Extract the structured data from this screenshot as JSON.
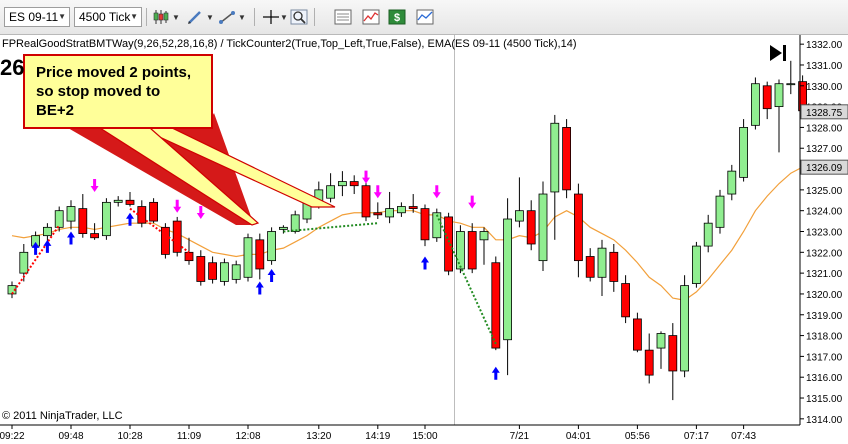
{
  "toolbar": {
    "instrument": "ES 09-11",
    "period": "4500 Tick",
    "icons": [
      "candlestick-icon",
      "chevron-down-icon",
      "pencil-icon",
      "chevron-down-icon",
      "crosshair-icon",
      "chevron-down-icon",
      "zoom-icon",
      "data-box-icon",
      "chart-properties-icon",
      "strategy-icon",
      "indicator-icon"
    ]
  },
  "chart_data": {
    "type": "candlestick",
    "indicator_label": "FPRealGoodStratBMTWay(9,26,52,28,16,8) / TickCounter2(True,Top_Left,True,False), EMA(ES 09-11 (4500 Tick),14)",
    "tick_counter_text": "26",
    "copyright": "© 2011 NinjaTrader, LLC",
    "annotation": "Price moved 2 points,\nso stop moved to\nBE+2",
    "price_ticks": [
      1314.0,
      1315.0,
      1316.0,
      1317.0,
      1318.0,
      1319.0,
      1320.0,
      1321.0,
      1322.0,
      1323.0,
      1324.0,
      1325.0,
      1326.0,
      1327.0,
      1328.0,
      1329.0,
      1330.0,
      1331.0,
      1332.0
    ],
    "price_labels": [
      "1314.00",
      "1315.00",
      "1316.00",
      "1317.00",
      "1318.00",
      "1319.00",
      "1320.00",
      "1321.00",
      "1322.00",
      "1323.00",
      "1324.00",
      "1325.00",
      "1326.00",
      "1327.00",
      "1328.00",
      "1329.00",
      "1330.00",
      "1331.00",
      "1332.00"
    ],
    "ylim": [
      1313.8,
      1332.2
    ],
    "last_price_label": "1328.75",
    "ema_price_label": "1326.09",
    "last_price": 1328.75,
    "ema_price": 1326.09,
    "time_labels": [
      "09:22",
      "09:48",
      "10:28",
      "11:09",
      "12:08",
      "13:20",
      "14:19",
      "15:00",
      "7/21",
      "04:01",
      "05:56",
      "07:17",
      "07:43"
    ],
    "time_label_bars": [
      0,
      5,
      10,
      15,
      20,
      26,
      31,
      35,
      43,
      48,
      53,
      58,
      62
    ],
    "session_break_bar": 37.5,
    "candles": [
      {
        "o": 1320.0,
        "h": 1320.6,
        "l": 1319.8,
        "c": 1320.4
      },
      {
        "o": 1321.0,
        "h": 1322.4,
        "l": 1320.6,
        "c": 1322.0
      },
      {
        "o": 1322.3,
        "h": 1323.0,
        "l": 1322.0,
        "c": 1322.8
      },
      {
        "o": 1322.8,
        "h": 1323.4,
        "l": 1322.4,
        "c": 1323.2
      },
      {
        "o": 1323.2,
        "h": 1324.2,
        "l": 1323.0,
        "c": 1324.0
      },
      {
        "o": 1323.5,
        "h": 1324.5,
        "l": 1323.1,
        "c": 1324.2
      },
      {
        "o": 1324.1,
        "h": 1324.8,
        "l": 1322.7,
        "c": 1322.9
      },
      {
        "o": 1322.9,
        "h": 1323.4,
        "l": 1322.6,
        "c": 1322.7
      },
      {
        "o": 1322.8,
        "h": 1324.6,
        "l": 1322.6,
        "c": 1324.4
      },
      {
        "o": 1324.4,
        "h": 1324.7,
        "l": 1324.2,
        "c": 1324.5
      },
      {
        "o": 1324.5,
        "h": 1324.9,
        "l": 1324.2,
        "c": 1324.3
      },
      {
        "o": 1324.2,
        "h": 1324.5,
        "l": 1323.2,
        "c": 1323.4
      },
      {
        "o": 1324.4,
        "h": 1324.6,
        "l": 1323.4,
        "c": 1323.5
      },
      {
        "o": 1323.2,
        "h": 1323.4,
        "l": 1321.7,
        "c": 1321.9
      },
      {
        "o": 1323.5,
        "h": 1323.7,
        "l": 1321.8,
        "c": 1322.0
      },
      {
        "o": 1322.0,
        "h": 1322.7,
        "l": 1321.4,
        "c": 1321.6
      },
      {
        "o": 1321.8,
        "h": 1322.1,
        "l": 1320.4,
        "c": 1320.6
      },
      {
        "o": 1321.5,
        "h": 1321.8,
        "l": 1320.5,
        "c": 1320.7
      },
      {
        "o": 1320.6,
        "h": 1321.7,
        "l": 1320.4,
        "c": 1321.5
      },
      {
        "o": 1320.7,
        "h": 1321.6,
        "l": 1320.5,
        "c": 1321.4
      },
      {
        "o": 1320.8,
        "h": 1322.9,
        "l": 1320.6,
        "c": 1322.7
      },
      {
        "o": 1322.6,
        "h": 1322.9,
        "l": 1320.7,
        "c": 1321.2
      },
      {
        "o": 1321.6,
        "h": 1323.2,
        "l": 1321.4,
        "c": 1323.0
      },
      {
        "o": 1323.1,
        "h": 1323.3,
        "l": 1322.9,
        "c": 1323.2
      },
      {
        "o": 1323.0,
        "h": 1324.0,
        "l": 1322.9,
        "c": 1323.8
      },
      {
        "o": 1323.6,
        "h": 1324.6,
        "l": 1323.4,
        "c": 1324.4
      },
      {
        "o": 1324.3,
        "h": 1325.4,
        "l": 1324.1,
        "c": 1325.0
      },
      {
        "o": 1324.6,
        "h": 1325.8,
        "l": 1324.4,
        "c": 1325.2
      },
      {
        "o": 1325.2,
        "h": 1325.9,
        "l": 1324.7,
        "c": 1325.4
      },
      {
        "o": 1325.4,
        "h": 1325.7,
        "l": 1324.8,
        "c": 1325.2
      },
      {
        "o": 1325.2,
        "h": 1325.4,
        "l": 1323.5,
        "c": 1323.7
      },
      {
        "o": 1323.9,
        "h": 1324.4,
        "l": 1323.6,
        "c": 1323.8
      },
      {
        "o": 1323.7,
        "h": 1324.9,
        "l": 1323.4,
        "c": 1324.1
      },
      {
        "o": 1323.9,
        "h": 1324.4,
        "l": 1323.7,
        "c": 1324.2
      },
      {
        "o": 1324.2,
        "h": 1324.8,
        "l": 1323.9,
        "c": 1324.1
      },
      {
        "o": 1324.1,
        "h": 1324.3,
        "l": 1322.3,
        "c": 1322.6
      },
      {
        "o": 1322.7,
        "h": 1324.1,
        "l": 1322.5,
        "c": 1323.9
      },
      {
        "o": 1323.7,
        "h": 1323.9,
        "l": 1320.9,
        "c": 1321.1
      },
      {
        "o": 1321.2,
        "h": 1323.3,
        "l": 1321.0,
        "c": 1323.0
      },
      {
        "o": 1323.0,
        "h": 1323.4,
        "l": 1321.0,
        "c": 1321.2
      },
      {
        "o": 1322.6,
        "h": 1323.2,
        "l": 1321.4,
        "c": 1323.0
      },
      {
        "o": 1321.5,
        "h": 1321.8,
        "l": 1317.3,
        "c": 1317.4
      },
      {
        "o": 1317.8,
        "h": 1324.6,
        "l": 1316.1,
        "c": 1323.6
      },
      {
        "o": 1323.5,
        "h": 1325.6,
        "l": 1323.2,
        "c": 1324.0
      },
      {
        "o": 1324.0,
        "h": 1324.5,
        "l": 1322.1,
        "c": 1322.4
      },
      {
        "o": 1321.6,
        "h": 1325.4,
        "l": 1321.1,
        "c": 1324.8
      },
      {
        "o": 1324.9,
        "h": 1328.6,
        "l": 1322.6,
        "c": 1328.2
      },
      {
        "o": 1328.0,
        "h": 1328.4,
        "l": 1324.6,
        "c": 1325.0
      },
      {
        "o": 1324.8,
        "h": 1325.3,
        "l": 1320.8,
        "c": 1321.6
      },
      {
        "o": 1321.8,
        "h": 1322.2,
        "l": 1320.6,
        "c": 1320.8
      },
      {
        "o": 1320.8,
        "h": 1322.6,
        "l": 1319.9,
        "c": 1322.2
      },
      {
        "o": 1322.0,
        "h": 1322.4,
        "l": 1320.1,
        "c": 1320.6
      },
      {
        "o": 1320.5,
        "h": 1320.9,
        "l": 1318.6,
        "c": 1318.9
      },
      {
        "o": 1318.8,
        "h": 1319.1,
        "l": 1317.2,
        "c": 1317.3
      },
      {
        "o": 1317.3,
        "h": 1318.1,
        "l": 1315.7,
        "c": 1316.1
      },
      {
        "o": 1317.4,
        "h": 1318.2,
        "l": 1316.4,
        "c": 1318.1
      },
      {
        "o": 1318.0,
        "h": 1318.6,
        "l": 1314.9,
        "c": 1316.3
      },
      {
        "o": 1316.3,
        "h": 1320.9,
        "l": 1316.0,
        "c": 1320.4
      },
      {
        "o": 1320.5,
        "h": 1322.5,
        "l": 1320.3,
        "c": 1322.3
      },
      {
        "o": 1322.3,
        "h": 1323.8,
        "l": 1322.0,
        "c": 1323.4
      },
      {
        "o": 1323.2,
        "h": 1325.0,
        "l": 1322.9,
        "c": 1324.7
      },
      {
        "o": 1324.8,
        "h": 1326.2,
        "l": 1324.5,
        "c": 1325.9
      },
      {
        "o": 1325.6,
        "h": 1328.4,
        "l": 1325.4,
        "c": 1328.0
      },
      {
        "o": 1328.1,
        "h": 1330.4,
        "l": 1327.9,
        "c": 1330.1
      },
      {
        "o": 1330.0,
        "h": 1330.2,
        "l": 1328.4,
        "c": 1328.9
      },
      {
        "o": 1329.0,
        "h": 1330.3,
        "l": 1326.8,
        "c": 1330.1
      },
      {
        "o": 1330.1,
        "h": 1331.2,
        "l": 1329.6,
        "c": 1330.1
      },
      {
        "o": 1330.2,
        "h": 1330.5,
        "l": 1328.6,
        "c": 1328.8
      }
    ],
    "ema": [
      1322.8,
      1322.7,
      1322.8,
      1322.9,
      1323.1,
      1323.2,
      1323.2,
      1323.1,
      1323.2,
      1323.3,
      1323.4,
      1323.4,
      1323.4,
      1323.1,
      1322.9,
      1322.6,
      1322.3,
      1322.0,
      1321.9,
      1321.8,
      1321.9,
      1321.9,
      1322.1,
      1322.2,
      1322.5,
      1322.8,
      1323.2,
      1323.5,
      1323.8,
      1323.9,
      1323.9,
      1323.9,
      1324.0,
      1324.0,
      1324.0,
      1323.8,
      1323.8,
      1323.5,
      1323.4,
      1323.2,
      1323.2,
      1322.6,
      1322.6,
      1322.8,
      1322.7,
      1323.0,
      1323.7,
      1324.0,
      1323.7,
      1323.2,
      1322.9,
      1322.6,
      1322.1,
      1321.5,
      1320.8,
      1320.4,
      1319.8,
      1319.7,
      1320.1,
      1320.7,
      1321.4,
      1322.1,
      1323.0,
      1324.0,
      1324.7,
      1325.3,
      1325.8,
      1326.1
    ],
    "buy_arrows": [
      {
        "bar": 2,
        "price": 1322.5
      },
      {
        "bar": 3,
        "price": 1322.6
      },
      {
        "bar": 5,
        "price": 1323.0
      },
      {
        "bar": 10,
        "price": 1323.9
      },
      {
        "bar": 21,
        "price": 1320.6
      },
      {
        "bar": 22,
        "price": 1321.2
      },
      {
        "bar": 35,
        "price": 1321.8
      },
      {
        "bar": 41,
        "price": 1316.5
      }
    ],
    "sell_arrows": [
      {
        "bar": 7,
        "price": 1324.9
      },
      {
        "bar": 14,
        "price": 1323.9
      },
      {
        "bar": 16,
        "price": 1323.6
      },
      {
        "bar": 30,
        "price": 1325.3
      },
      {
        "bar": 31,
        "price": 1324.6
      },
      {
        "bar": 36,
        "price": 1324.6
      },
      {
        "bar": 39,
        "price": 1324.1
      }
    ],
    "trade_lines": [
      {
        "from_bar": 0,
        "from_price": 1320.0,
        "to_bar": 4,
        "to_price": 1323.3,
        "color": "#ff0000"
      },
      {
        "from_bar": 10,
        "from_price": 1324.1,
        "to_bar": 15,
        "to_price": 1322.0,
        "color": "#ff0000"
      },
      {
        "from_bar": 23,
        "from_price": 1323.0,
        "to_bar": 31,
        "to_price": 1323.4,
        "color": "#228b22"
      },
      {
        "from_bar": 36,
        "from_price": 1323.8,
        "to_bar": 41,
        "to_price": 1317.6,
        "color": "#228b22"
      }
    ],
    "colors": {
      "up": "#90ee90",
      "down": "#ff0000",
      "ema": "#f2a03b",
      "buy_arrow": "#0000ff",
      "sell_arrow": "#ff00ff",
      "callout_fill": "#ffff99",
      "callout_border": "#d00000"
    }
  }
}
